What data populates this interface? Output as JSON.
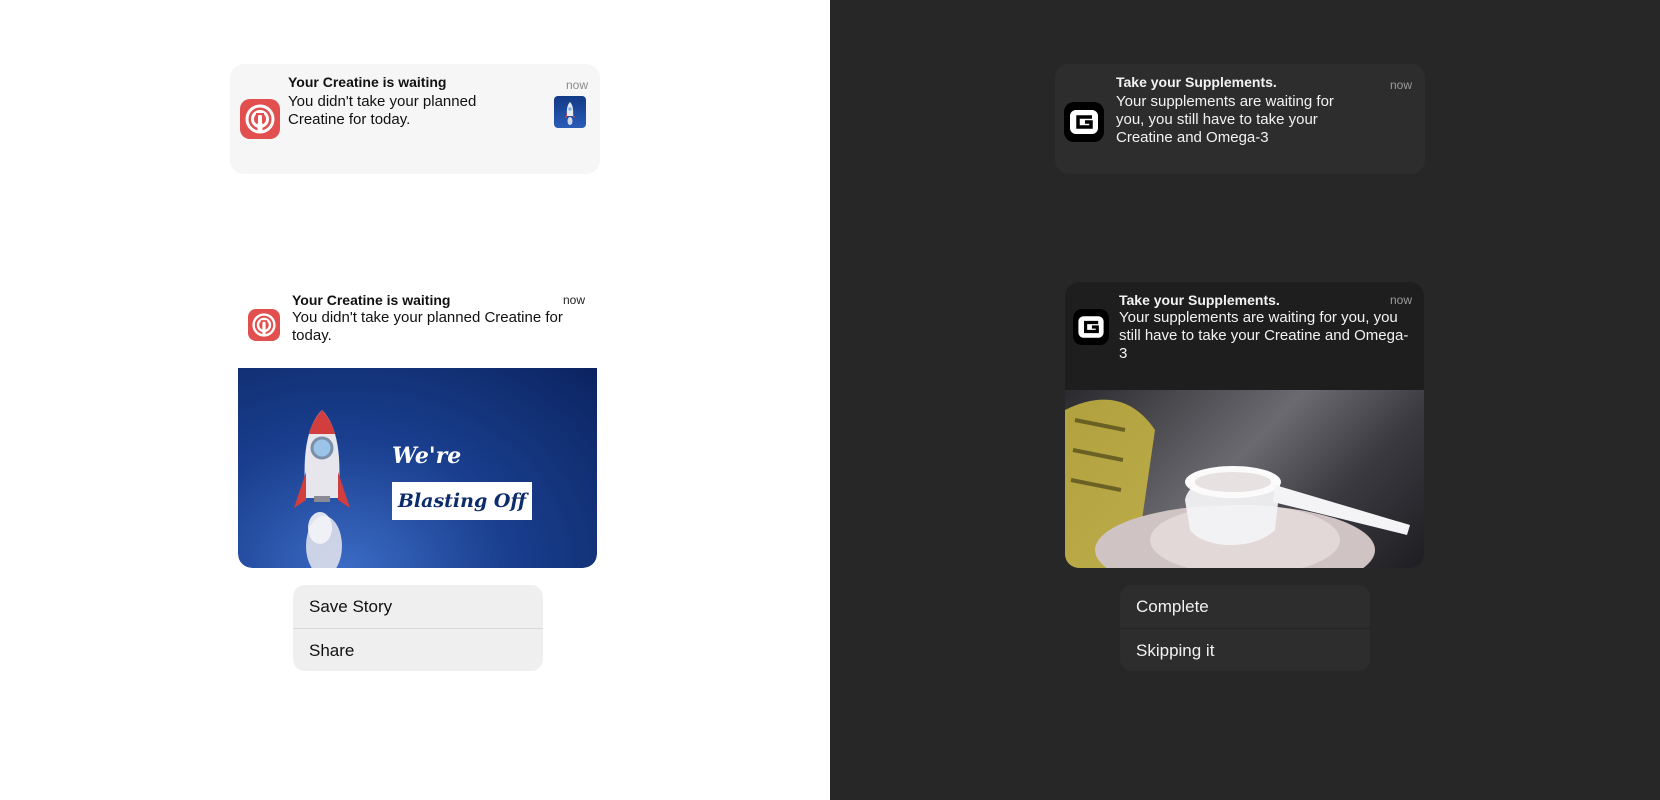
{
  "light": {
    "collapsed": {
      "title": "Your Creatine is waiting",
      "body": "You didn't take your planned Creatine for today.",
      "time": "now",
      "app_icon": "podcast-broadcast-icon",
      "thumbnail_icon": "rocket-thumbnail"
    },
    "expanded": {
      "title": "Your Creatine is waiting",
      "body": "You didn't take your planned Creatine for today.",
      "time": "now",
      "app_icon": "podcast-broadcast-icon",
      "image": {
        "headline": "We're",
        "banner": "Blasting Off"
      },
      "actions": [
        "Save Story",
        "Share"
      ]
    }
  },
  "dark": {
    "collapsed": {
      "title": "Take your Supplements.",
      "body": "Your supplements are waiting for you, you still have to take your Creatine and Omega-3",
      "time": "now",
      "app_icon": "g-logo-icon"
    },
    "expanded": {
      "title": "Take your Supplements.",
      "body": "Your supplements are waiting for you, you still have to take your Creatine and Omega-3",
      "time": "now",
      "app_icon": "g-logo-icon",
      "image": "supplement-powder-scoop-photo",
      "actions": [
        "Complete",
        "Skipping it"
      ]
    }
  },
  "colors": {
    "light_background": "#ffffff",
    "dark_background": "#272727",
    "app_red": "#e14f4f",
    "rocket_blue": "#0d2c6b"
  }
}
